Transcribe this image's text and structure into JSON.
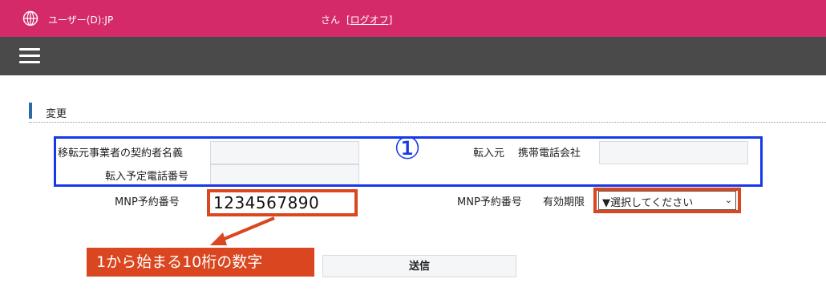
{
  "header": {
    "user_label": "ユーザー(D):JP",
    "san": "さん",
    "logout": "[ログオフ]",
    "brand_color": "#d42a6a",
    "globe_icon": "globe-icon"
  },
  "nav": {
    "menu_icon": "hamburger-icon",
    "color": "#4a4a4a"
  },
  "section": {
    "title": "変更"
  },
  "form": {
    "transfer_contract_name_label": "移転元事業者の契約者名義",
    "transfer_phone_label": "転入予定電話番号",
    "transfer_source_label": "転入元",
    "carrier_label": "携帯電話会社",
    "mnp_number_label": "MNP予約番号",
    "mnp_number_value": "1234567890",
    "mnp_expiry_label": "MNP予約番号",
    "expiry_label": "有効期限",
    "expiry_select_value": "▼選択してください"
  },
  "annotations": {
    "circle_label": "①",
    "callout": "1から始まる10桁の数字",
    "box_color": "#1538e8",
    "highlight_color": "#d9461f"
  },
  "submit_label": "送信"
}
